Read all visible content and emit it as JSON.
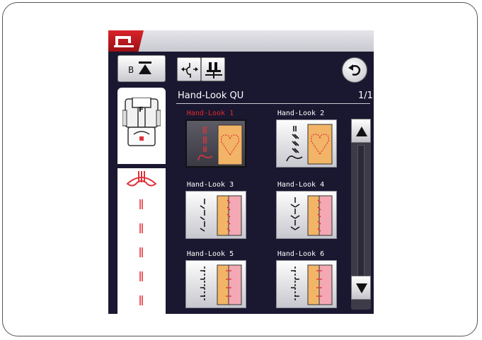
{
  "header": {
    "foot_button_letter": "B",
    "group_title": "Hand-Look QU",
    "page_indicator": "1/1"
  },
  "foot": {
    "letter": "F"
  },
  "patterns": [
    {
      "label": "Hand-Look 1",
      "selected": true
    },
    {
      "label": "Hand-Look 2",
      "selected": false
    },
    {
      "label": "Hand-Look 3",
      "selected": false
    },
    {
      "label": "Hand-Look 4",
      "selected": false
    },
    {
      "label": "Hand-Look 5",
      "selected": false
    },
    {
      "label": "Hand-Look 6",
      "selected": false
    }
  ],
  "colors": {
    "screen_bg": "#1a1730",
    "accent_red": "#e12c2c",
    "stitch_red": "#e0323a",
    "fabric_orange": "#f2b567",
    "fabric_pink": "#f3a8b4"
  }
}
